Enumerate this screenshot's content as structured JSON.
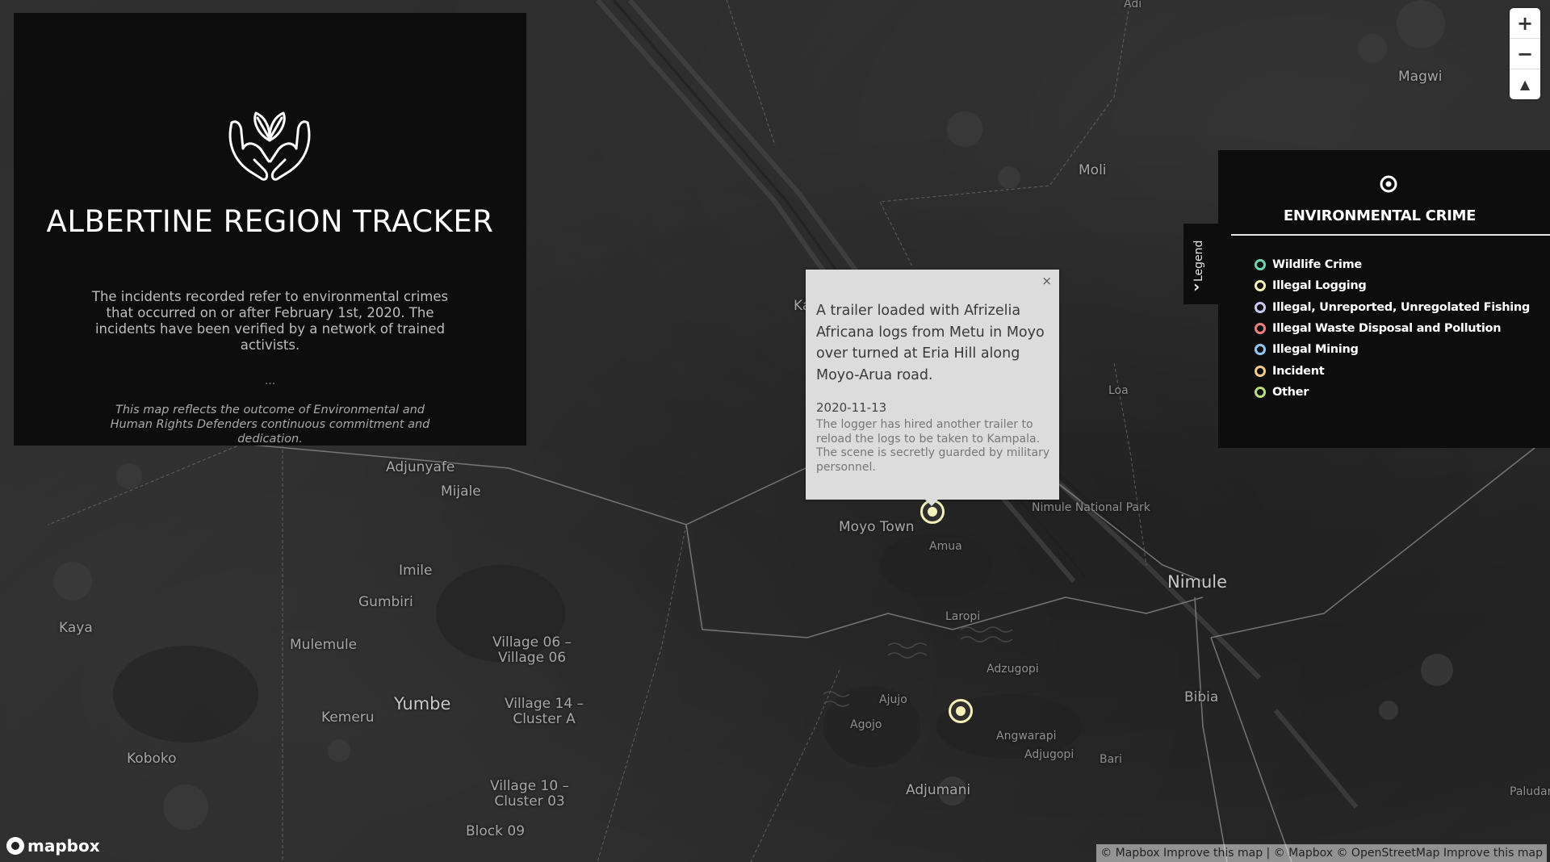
{
  "info_panel": {
    "title": "ALBERTINE REGION TRACKER",
    "description": "The incidents recorded refer to environmental crimes that occurred on or after February 1st, 2020. The incidents have been verified by a network of trained activists.",
    "dots": "...",
    "footnote": "This map reflects the outcome of Environmental and Human Rights Defenders continuous commitment and dedication.",
    "logo_icon": "hands-leaf-icon"
  },
  "popup": {
    "close_label": "×",
    "headline": "A trailer loaded with Afrizelia Africana logs from Metu in Moyo over turned at Eria Hill along Moyo-Arua road.",
    "date": "2020-11-13",
    "details": "The logger has hired another trailer to reload the logs to be taken to Kampala. The scene is secretly guarded by military personnel."
  },
  "legend": {
    "tab_label": "Legend",
    "title": "ENVIRONMENTAL CRIME",
    "items": [
      {
        "label": "Wildlife Crime",
        "color": "#6fd3b8"
      },
      {
        "label": "Illegal Logging",
        "color": "#f6f1b8"
      },
      {
        "label": "Illegal, Unreported, Unregolated Fishing",
        "color": "#c8c8f0"
      },
      {
        "label": "Illegal Waste Disposal and Pollution",
        "color": "#f08080"
      },
      {
        "label": "Illegal Mining",
        "color": "#8fc8f0"
      },
      {
        "label": "Incident",
        "color": "#f6c98a"
      },
      {
        "label": "Other",
        "color": "#b8e07a"
      }
    ]
  },
  "zoom": {
    "zoom_in": "+",
    "zoom_out": "−",
    "compass": "▲"
  },
  "places": [
    {
      "name": "Adi",
      "cls": "small"
    },
    {
      "name": "Magwi",
      "cls": ""
    },
    {
      "name": "Moli",
      "cls": ""
    },
    {
      "name": "Ka",
      "cls": ""
    },
    {
      "name": "Loa",
      "cls": "small"
    },
    {
      "name": "Adjunyafe",
      "cls": ""
    },
    {
      "name": "Mijale",
      "cls": ""
    },
    {
      "name": "Nimule National Park",
      "cls": "small"
    },
    {
      "name": "Moyo Town",
      "cls": ""
    },
    {
      "name": "Amua",
      "cls": "small"
    },
    {
      "name": "Nimule",
      "cls": "big"
    },
    {
      "name": "Imile",
      "cls": ""
    },
    {
      "name": "Gumbiri",
      "cls": ""
    },
    {
      "name": "Laropi",
      "cls": "small"
    },
    {
      "name": "Kaya",
      "cls": ""
    },
    {
      "name": "Mulemule",
      "cls": ""
    },
    {
      "name": "Village 06 – Village 06",
      "cls": ""
    },
    {
      "name": "Adzugopi",
      "cls": "small"
    },
    {
      "name": "Bibia",
      "cls": ""
    },
    {
      "name": "Yumbe",
      "cls": "big"
    },
    {
      "name": "Village 14 – Cluster A",
      "cls": ""
    },
    {
      "name": "Ajujo",
      "cls": "small"
    },
    {
      "name": "Kemeru",
      "cls": ""
    },
    {
      "name": "Agojo",
      "cls": "small"
    },
    {
      "name": "Angwarapi",
      "cls": "small"
    },
    {
      "name": "Adjugopi",
      "cls": "small"
    },
    {
      "name": "Bari",
      "cls": "small"
    },
    {
      "name": "Koboko",
      "cls": ""
    },
    {
      "name": "Adjumani",
      "cls": ""
    },
    {
      "name": "Paludar",
      "cls": "small"
    },
    {
      "name": "Village 10 – Cluster 03",
      "cls": ""
    },
    {
      "name": "Block 09",
      "cls": ""
    }
  ],
  "attribution": {
    "brand": "mapbox",
    "text1": "© Mapbox",
    "link1": "Improve this map",
    "sep": "|",
    "text2": "© Mapbox",
    "text3": "© OpenStreetMap",
    "link2": "Improve this map"
  }
}
